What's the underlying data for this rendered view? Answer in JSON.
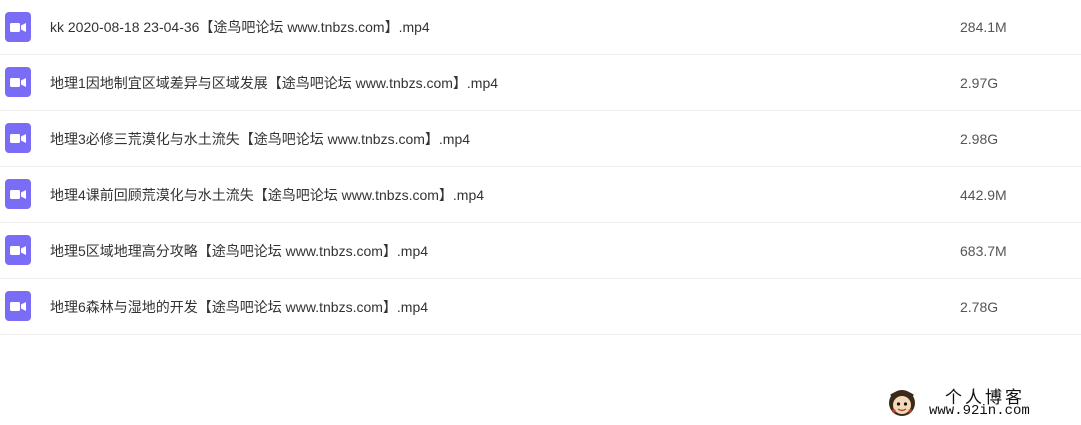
{
  "files": [
    {
      "name": "kk 2020-08-18 23-04-36【途鸟吧论坛 www.tnbzs.com】.mp4",
      "size": "284.1M",
      "icon": "video-file-icon"
    },
    {
      "name": "地理1因地制宜区域差异与区域发展【途鸟吧论坛 www.tnbzs.com】.mp4",
      "size": "2.97G",
      "icon": "video-file-icon"
    },
    {
      "name": "地理3必修三荒漠化与水土流失【途鸟吧论坛 www.tnbzs.com】.mp4",
      "size": "2.98G",
      "icon": "video-file-icon"
    },
    {
      "name": "地理4课前回顾荒漠化与水土流失【途鸟吧论坛 www.tnbzs.com】.mp4",
      "size": "442.9M",
      "icon": "video-file-icon"
    },
    {
      "name": "地理5区域地理高分攻略【途鸟吧论坛 www.tnbzs.com】.mp4",
      "size": "683.7M",
      "icon": "video-file-icon"
    },
    {
      "name": "地理6森林与湿地的开发【途鸟吧论坛 www.tnbzs.com】.mp4",
      "size": "2.78G",
      "icon": "video-file-icon"
    }
  ],
  "watermark": {
    "title": "个人博客",
    "url": "www.92in.com"
  },
  "colors": {
    "icon_bg": "#7b6cf6",
    "text": "#333333",
    "divider": "#f0f0f0"
  }
}
